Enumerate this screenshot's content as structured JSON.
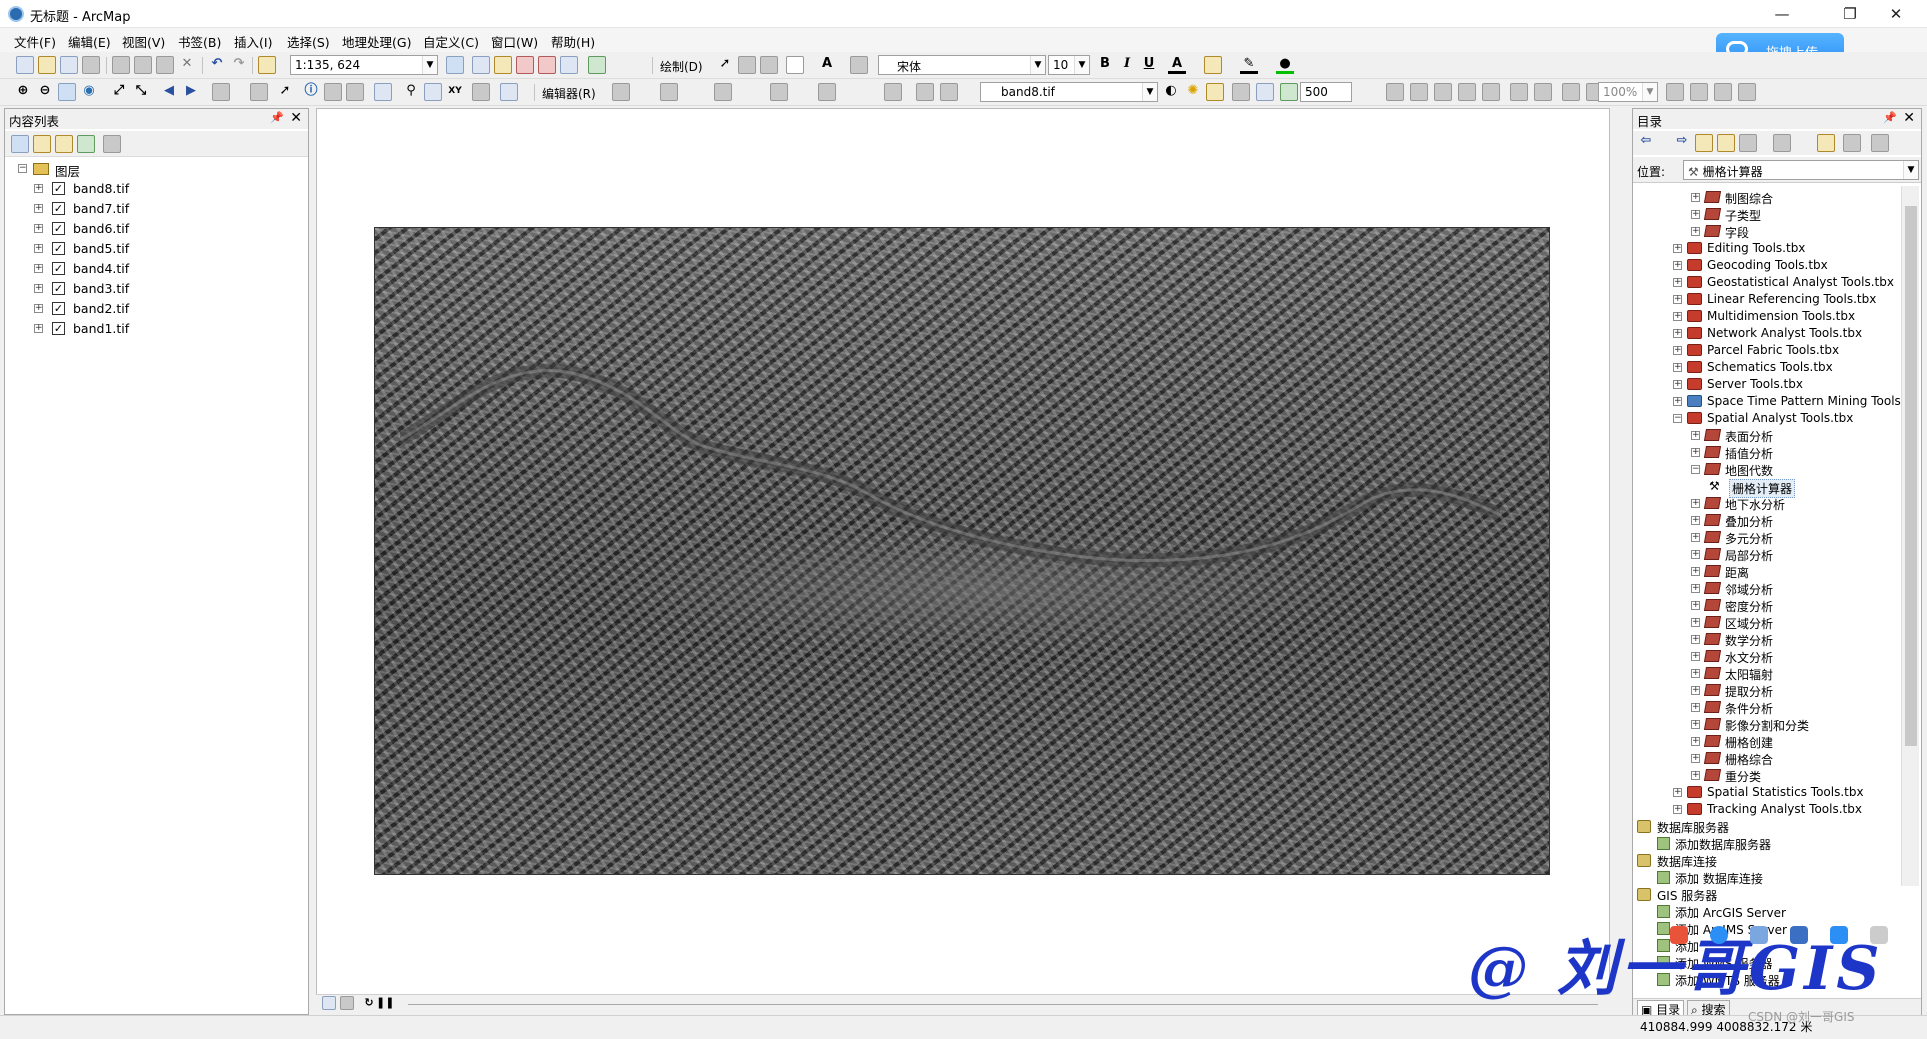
{
  "window": {
    "title": "无标题 - ArcMap"
  },
  "menu": [
    "文件(F)",
    "编辑(E)",
    "视图(V)",
    "书签(B)",
    "插入(I)",
    "选择(S)",
    "地理处理(G)",
    "自定义(C)",
    "窗口(W)",
    "帮助(H)"
  ],
  "upload_button": "拖拽上传",
  "toolbar": {
    "scale_value": "1:135, 624",
    "draw_menu": "绘制(D)",
    "font_name": "宋体",
    "font_size": "10",
    "bold": "B",
    "italic": "I",
    "underline": "U",
    "editor_menu": "编辑器(R)",
    "layer_select": "band8.tif",
    "transparency_value": "500",
    "zoom_value": "100%"
  },
  "toc": {
    "title": "内容列表",
    "group": "图层",
    "layers": [
      "band8.tif",
      "band7.tif",
      "band6.tif",
      "band5.tif",
      "band4.tif",
      "band3.tif",
      "band2.tif",
      "band1.tif"
    ]
  },
  "catalog": {
    "title": "目录",
    "location_label": "位置:",
    "location_value": "栅格计算器",
    "items": [
      {
        "label": "制图综合",
        "type": "toolset",
        "indent": 3
      },
      {
        "label": "子类型",
        "type": "toolset",
        "indent": 3
      },
      {
        "label": "字段",
        "type": "toolset",
        "indent": 3
      },
      {
        "label": "Editing Tools.tbx",
        "type": "toolbox",
        "indent": 2
      },
      {
        "label": "Geocoding Tools.tbx",
        "type": "toolbox",
        "indent": 2
      },
      {
        "label": "Geostatistical Analyst Tools.tbx",
        "type": "toolbox",
        "indent": 2
      },
      {
        "label": "Linear Referencing Tools.tbx",
        "type": "toolbox",
        "indent": 2
      },
      {
        "label": "Multidimension Tools.tbx",
        "type": "toolbox",
        "indent": 2
      },
      {
        "label": "Network Analyst Tools.tbx",
        "type": "toolbox",
        "indent": 2
      },
      {
        "label": "Parcel Fabric Tools.tbx",
        "type": "toolbox",
        "indent": 2
      },
      {
        "label": "Schematics Tools.tbx",
        "type": "toolbox",
        "indent": 2
      },
      {
        "label": "Server Tools.tbx",
        "type": "toolbox",
        "indent": 2
      },
      {
        "label": "Space Time Pattern Mining Tools.py",
        "type": "toolbox-py",
        "indent": 2
      },
      {
        "label": "Spatial Analyst Tools.tbx",
        "type": "toolbox-open",
        "indent": 2
      },
      {
        "label": "表面分析",
        "type": "toolset",
        "indent": 3
      },
      {
        "label": "插值分析",
        "type": "toolset",
        "indent": 3
      },
      {
        "label": "地图代数",
        "type": "toolset-open",
        "indent": 3
      },
      {
        "label": "栅格计算器",
        "type": "tool-selected",
        "indent": 4
      },
      {
        "label": "地下水分析",
        "type": "toolset",
        "indent": 3
      },
      {
        "label": "叠加分析",
        "type": "toolset",
        "indent": 3
      },
      {
        "label": "多元分析",
        "type": "toolset",
        "indent": 3
      },
      {
        "label": "局部分析",
        "type": "toolset",
        "indent": 3
      },
      {
        "label": "距离",
        "type": "toolset",
        "indent": 3
      },
      {
        "label": "邻域分析",
        "type": "toolset",
        "indent": 3
      },
      {
        "label": "密度分析",
        "type": "toolset",
        "indent": 3
      },
      {
        "label": "区域分析",
        "type": "toolset",
        "indent": 3
      },
      {
        "label": "数学分析",
        "type": "toolset",
        "indent": 3
      },
      {
        "label": "水文分析",
        "type": "toolset",
        "indent": 3
      },
      {
        "label": "太阳辐射",
        "type": "toolset",
        "indent": 3
      },
      {
        "label": "提取分析",
        "type": "toolset",
        "indent": 3
      },
      {
        "label": "条件分析",
        "type": "toolset",
        "indent": 3
      },
      {
        "label": "影像分割和分类",
        "type": "toolset",
        "indent": 3
      },
      {
        "label": "栅格创建",
        "type": "toolset",
        "indent": 3
      },
      {
        "label": "栅格综合",
        "type": "toolset",
        "indent": 3
      },
      {
        "label": "重分类",
        "type": "toolset",
        "indent": 3
      },
      {
        "label": "Spatial Statistics Tools.tbx",
        "type": "toolbox",
        "indent": 2
      },
      {
        "label": "Tracking Analyst Tools.tbx",
        "type": "toolbox",
        "indent": 2
      },
      {
        "label": "数据库服务器",
        "type": "folder",
        "indent": 0
      },
      {
        "label": "添加数据库服务器",
        "type": "add",
        "indent": 1
      },
      {
        "label": "数据库连接",
        "type": "folder",
        "indent": 0
      },
      {
        "label": "添加 数据库连接",
        "type": "add",
        "indent": 1
      },
      {
        "label": "GIS 服务器",
        "type": "folder",
        "indent": 0
      },
      {
        "label": "添加 ArcGIS Server",
        "type": "add",
        "indent": 1
      },
      {
        "label": "添加 ArcIMS Server",
        "type": "add",
        "indent": 1
      },
      {
        "label": "添加",
        "type": "add",
        "indent": 1
      },
      {
        "label": "添加 WMS 服务器",
        "type": "add",
        "indent": 1
      },
      {
        "label": "添加 WMTS 服务器",
        "type": "add",
        "indent": 1
      }
    ],
    "tabs": [
      "目录",
      "搜索"
    ]
  },
  "status": {
    "coordinates": "410884.999  4008832.172 米"
  },
  "watermark": {
    "text": "@ 刘一哥GIS",
    "csdn": "CSDN @刘一哥GIS"
  }
}
